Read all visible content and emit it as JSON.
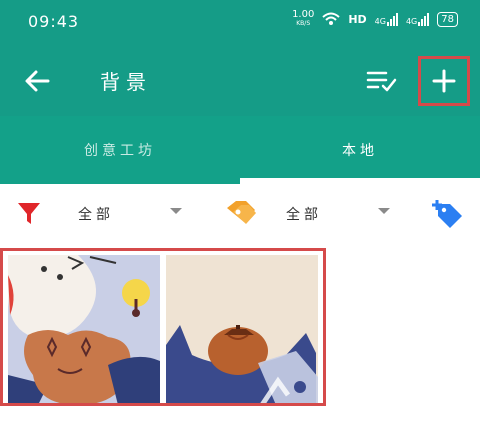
{
  "status_bar": {
    "time": "09:43",
    "net_speed_value": "1.00",
    "net_speed_unit": "KB/S",
    "hd_label": "HD",
    "signal1_label": "4G",
    "signal2_label": "4G",
    "battery": "78"
  },
  "header": {
    "title": "背景",
    "back_icon": "arrow-left-icon",
    "checklist_icon": "checklist-icon",
    "add_icon": "plus-icon"
  },
  "tabs": [
    {
      "label": "创意工坊",
      "selected": false
    },
    {
      "label": "本地",
      "selected": true
    }
  ],
  "filters": {
    "category_icon": "funnel-icon",
    "category_value": "全部",
    "tag_icon": "tags-icon",
    "tag_value": "全部",
    "add_tag_icon": "add-tag-icon"
  },
  "colors": {
    "primary": "#159c87",
    "tab_bar": "#13a189",
    "highlight": "#d54a4a",
    "funnel": "#e0262a",
    "tag": "#f2a12b",
    "add_tag": "#2b7ff2"
  },
  "gallery": {
    "items": [
      {
        "name": "wallpaper-bear-bird"
      },
      {
        "name": "wallpaper-pumpkin-cat"
      }
    ]
  }
}
